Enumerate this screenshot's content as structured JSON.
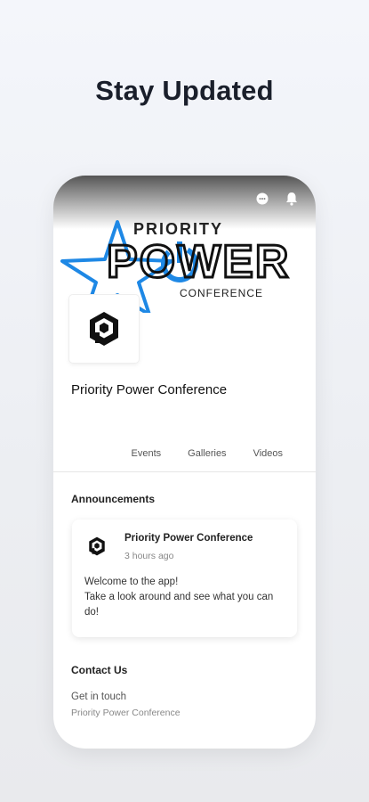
{
  "headline": "Stay Updated",
  "status_icons": [
    "chat-icon",
    "bell-icon"
  ],
  "banner": {
    "line1": "PRIORITY",
    "line2": "POWER",
    "line3": "CONFERENCE",
    "accent_color": "#1e88e5"
  },
  "profile": {
    "name": "Priority Power Conference"
  },
  "tabs": [
    {
      "label": "Events"
    },
    {
      "label": "Galleries"
    },
    {
      "label": "Videos"
    }
  ],
  "announcements": {
    "title": "Announcements",
    "post": {
      "author": "Priority Power Conference",
      "time": "3 hours ago",
      "body_line1": "Welcome to the app!",
      "body_line2": "Take a look around and see what you can do!"
    }
  },
  "contact": {
    "title": "Contact Us",
    "subtitle": "Get in touch",
    "org": "Priority Power Conference"
  }
}
